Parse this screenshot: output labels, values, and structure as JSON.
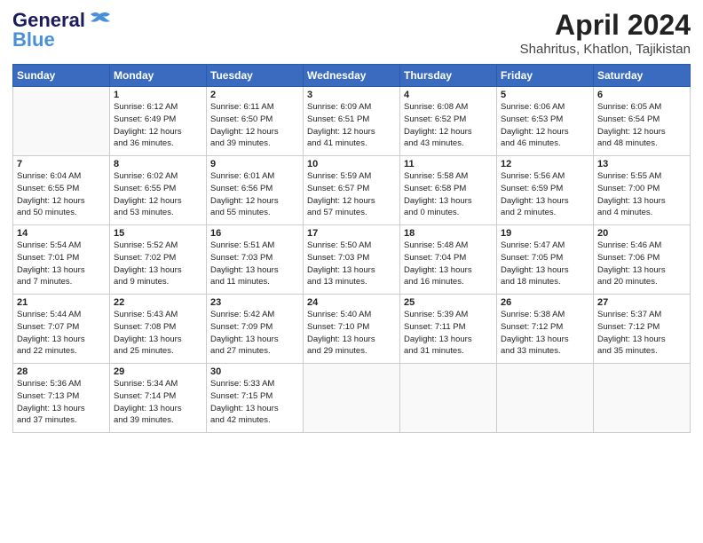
{
  "logo": {
    "line1": "General",
    "line2": "Blue"
  },
  "title": "April 2024",
  "location": "Shahritus, Khatlon, Tajikistan",
  "days_header": [
    "Sunday",
    "Monday",
    "Tuesday",
    "Wednesday",
    "Thursday",
    "Friday",
    "Saturday"
  ],
  "weeks": [
    [
      {
        "num": "",
        "info": ""
      },
      {
        "num": "1",
        "info": "Sunrise: 6:12 AM\nSunset: 6:49 PM\nDaylight: 12 hours\nand 36 minutes."
      },
      {
        "num": "2",
        "info": "Sunrise: 6:11 AM\nSunset: 6:50 PM\nDaylight: 12 hours\nand 39 minutes."
      },
      {
        "num": "3",
        "info": "Sunrise: 6:09 AM\nSunset: 6:51 PM\nDaylight: 12 hours\nand 41 minutes."
      },
      {
        "num": "4",
        "info": "Sunrise: 6:08 AM\nSunset: 6:52 PM\nDaylight: 12 hours\nand 43 minutes."
      },
      {
        "num": "5",
        "info": "Sunrise: 6:06 AM\nSunset: 6:53 PM\nDaylight: 12 hours\nand 46 minutes."
      },
      {
        "num": "6",
        "info": "Sunrise: 6:05 AM\nSunset: 6:54 PM\nDaylight: 12 hours\nand 48 minutes."
      }
    ],
    [
      {
        "num": "7",
        "info": "Sunrise: 6:04 AM\nSunset: 6:55 PM\nDaylight: 12 hours\nand 50 minutes."
      },
      {
        "num": "8",
        "info": "Sunrise: 6:02 AM\nSunset: 6:55 PM\nDaylight: 12 hours\nand 53 minutes."
      },
      {
        "num": "9",
        "info": "Sunrise: 6:01 AM\nSunset: 6:56 PM\nDaylight: 12 hours\nand 55 minutes."
      },
      {
        "num": "10",
        "info": "Sunrise: 5:59 AM\nSunset: 6:57 PM\nDaylight: 12 hours\nand 57 minutes."
      },
      {
        "num": "11",
        "info": "Sunrise: 5:58 AM\nSunset: 6:58 PM\nDaylight: 13 hours\nand 0 minutes."
      },
      {
        "num": "12",
        "info": "Sunrise: 5:56 AM\nSunset: 6:59 PM\nDaylight: 13 hours\nand 2 minutes."
      },
      {
        "num": "13",
        "info": "Sunrise: 5:55 AM\nSunset: 7:00 PM\nDaylight: 13 hours\nand 4 minutes."
      }
    ],
    [
      {
        "num": "14",
        "info": "Sunrise: 5:54 AM\nSunset: 7:01 PM\nDaylight: 13 hours\nand 7 minutes."
      },
      {
        "num": "15",
        "info": "Sunrise: 5:52 AM\nSunset: 7:02 PM\nDaylight: 13 hours\nand 9 minutes."
      },
      {
        "num": "16",
        "info": "Sunrise: 5:51 AM\nSunset: 7:03 PM\nDaylight: 13 hours\nand 11 minutes."
      },
      {
        "num": "17",
        "info": "Sunrise: 5:50 AM\nSunset: 7:03 PM\nDaylight: 13 hours\nand 13 minutes."
      },
      {
        "num": "18",
        "info": "Sunrise: 5:48 AM\nSunset: 7:04 PM\nDaylight: 13 hours\nand 16 minutes."
      },
      {
        "num": "19",
        "info": "Sunrise: 5:47 AM\nSunset: 7:05 PM\nDaylight: 13 hours\nand 18 minutes."
      },
      {
        "num": "20",
        "info": "Sunrise: 5:46 AM\nSunset: 7:06 PM\nDaylight: 13 hours\nand 20 minutes."
      }
    ],
    [
      {
        "num": "21",
        "info": "Sunrise: 5:44 AM\nSunset: 7:07 PM\nDaylight: 13 hours\nand 22 minutes."
      },
      {
        "num": "22",
        "info": "Sunrise: 5:43 AM\nSunset: 7:08 PM\nDaylight: 13 hours\nand 25 minutes."
      },
      {
        "num": "23",
        "info": "Sunrise: 5:42 AM\nSunset: 7:09 PM\nDaylight: 13 hours\nand 27 minutes."
      },
      {
        "num": "24",
        "info": "Sunrise: 5:40 AM\nSunset: 7:10 PM\nDaylight: 13 hours\nand 29 minutes."
      },
      {
        "num": "25",
        "info": "Sunrise: 5:39 AM\nSunset: 7:11 PM\nDaylight: 13 hours\nand 31 minutes."
      },
      {
        "num": "26",
        "info": "Sunrise: 5:38 AM\nSunset: 7:12 PM\nDaylight: 13 hours\nand 33 minutes."
      },
      {
        "num": "27",
        "info": "Sunrise: 5:37 AM\nSunset: 7:12 PM\nDaylight: 13 hours\nand 35 minutes."
      }
    ],
    [
      {
        "num": "28",
        "info": "Sunrise: 5:36 AM\nSunset: 7:13 PM\nDaylight: 13 hours\nand 37 minutes."
      },
      {
        "num": "29",
        "info": "Sunrise: 5:34 AM\nSunset: 7:14 PM\nDaylight: 13 hours\nand 39 minutes."
      },
      {
        "num": "30",
        "info": "Sunrise: 5:33 AM\nSunset: 7:15 PM\nDaylight: 13 hours\nand 42 minutes."
      },
      {
        "num": "",
        "info": ""
      },
      {
        "num": "",
        "info": ""
      },
      {
        "num": "",
        "info": ""
      },
      {
        "num": "",
        "info": ""
      }
    ]
  ]
}
